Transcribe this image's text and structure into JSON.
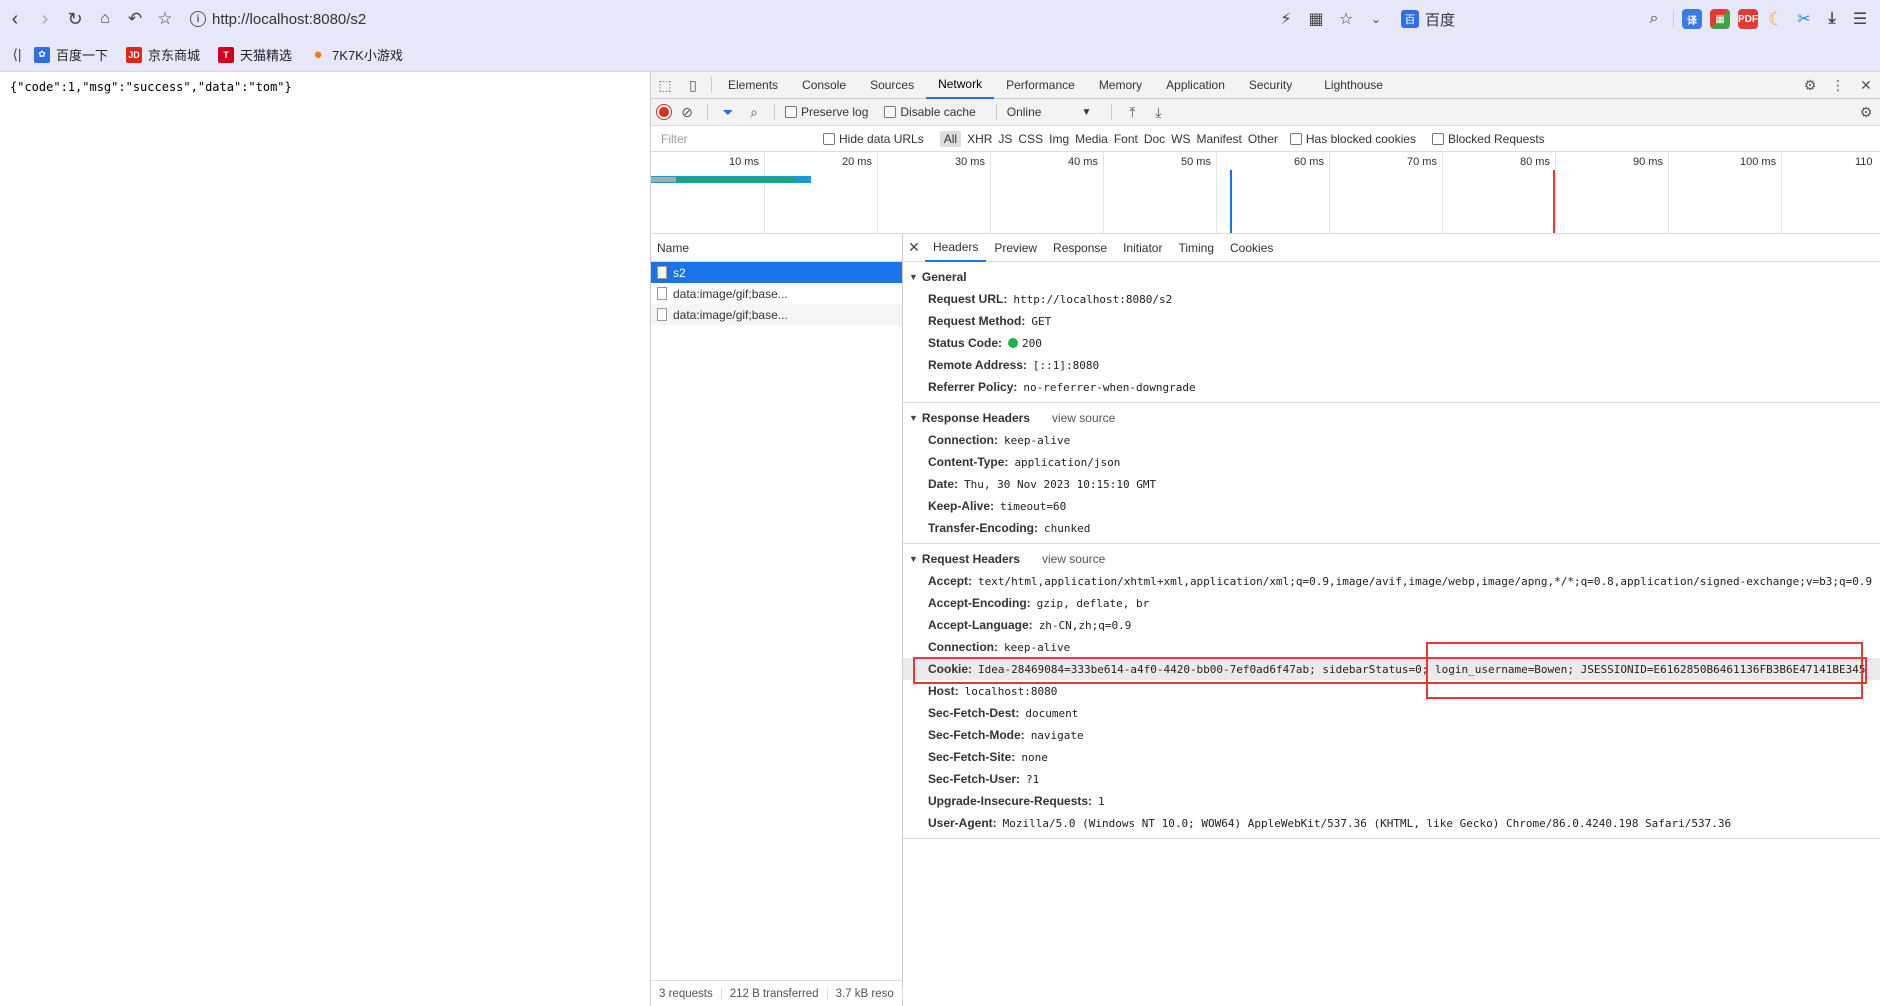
{
  "browser": {
    "url": "http://localhost:8080/s2",
    "search_engine": "百度",
    "bookmarks": [
      {
        "label": "百度一下",
        "icon": "baidu-paw-icon",
        "color": "#2f6fe6",
        "glyph": "🐾"
      },
      {
        "label": "京东商城",
        "icon": "jd-logo-icon",
        "color": "#e1251b",
        "glyph": "JD"
      },
      {
        "label": "天猫精选",
        "icon": "tmall-logo-icon",
        "color": "#d1001f",
        "glyph": "T"
      },
      {
        "label": "7K7K小游戏",
        "icon": "balloon-icon",
        "color": "#f57c00",
        "glyph": "●"
      }
    ]
  },
  "page": {
    "json_text": "{\"code\":1,\"msg\":\"success\",\"data\":\"tom\"}"
  },
  "devtools": {
    "tabs": [
      "Elements",
      "Console",
      "Sources",
      "Network",
      "Performance",
      "Memory",
      "Application",
      "Security",
      "Lighthouse"
    ],
    "active_tab": "Network",
    "toolbar": {
      "preserve_log": "Preserve log",
      "disable_cache": "Disable cache",
      "throttle": "Online"
    },
    "filter": {
      "placeholder": "Filter",
      "hide_data_urls": "Hide data URLs",
      "types": [
        "All",
        "XHR",
        "JS",
        "CSS",
        "Img",
        "Media",
        "Font",
        "Doc",
        "WS",
        "Manifest",
        "Other"
      ],
      "has_blocked_cookies": "Has blocked cookies",
      "blocked_requests": "Blocked Requests"
    },
    "timeline_ticks": [
      "10 ms",
      "20 ms",
      "30 ms",
      "40 ms",
      "50 ms",
      "60 ms",
      "70 ms",
      "80 ms",
      "90 ms",
      "100 ms",
      "110"
    ],
    "name_header": "Name",
    "requests": [
      "s2",
      "data:image/gif;base...",
      "data:image/gif;base..."
    ],
    "footer": {
      "requests": "3 requests",
      "transferred": "212 B transferred",
      "resources": "3.7 kB reso"
    },
    "detail_tabs": [
      "Headers",
      "Preview",
      "Response",
      "Initiator",
      "Timing",
      "Cookies"
    ],
    "general": {
      "title": "General",
      "rows": [
        {
          "key": "Request URL:",
          "value": "http://localhost:8080/s2"
        },
        {
          "key": "Request Method:",
          "value": "GET"
        },
        {
          "key": "Status Code:",
          "value": "200"
        },
        {
          "key": "Remote Address:",
          "value": "[::1]:8080"
        },
        {
          "key": "Referrer Policy:",
          "value": "no-referrer-when-downgrade"
        }
      ]
    },
    "response_headers": {
      "title": "Response Headers",
      "view_source": "view source",
      "rows": [
        {
          "key": "Connection:",
          "value": "keep-alive"
        },
        {
          "key": "Content-Type:",
          "value": "application/json"
        },
        {
          "key": "Date:",
          "value": "Thu, 30 Nov 2023 10:15:10 GMT"
        },
        {
          "key": "Keep-Alive:",
          "value": "timeout=60"
        },
        {
          "key": "Transfer-Encoding:",
          "value": "chunked"
        }
      ]
    },
    "request_headers": {
      "title": "Request Headers",
      "view_source": "view source",
      "rows": [
        {
          "key": "Accept:",
          "value": "text/html,application/xhtml+xml,application/xml;q=0.9,image/avif,image/webp,image/apng,*/*;q=0.8,application/signed-exchange;v=b3;q=0.9"
        },
        {
          "key": "Accept-Encoding:",
          "value": "gzip, deflate, br"
        },
        {
          "key": "Accept-Language:",
          "value": "zh-CN,zh;q=0.9"
        },
        {
          "key": "Connection:",
          "value": "keep-alive"
        },
        {
          "key": "Cookie:",
          "value": "Idea-28469084=333be614-a4f0-4420-bb00-7ef0ad6f47ab; sidebarStatus=0; login_username=Bowen; JSESSIONID=E6162850B6461136FB3B6E47141BE345"
        },
        {
          "key": "Host:",
          "value": "localhost:8080"
        },
        {
          "key": "Sec-Fetch-Dest:",
          "value": "document"
        },
        {
          "key": "Sec-Fetch-Mode:",
          "value": "navigate"
        },
        {
          "key": "Sec-Fetch-Site:",
          "value": "none"
        },
        {
          "key": "Sec-Fetch-User:",
          "value": "?1"
        },
        {
          "key": "Upgrade-Insecure-Requests:",
          "value": "1"
        },
        {
          "key": "User-Agent:",
          "value": "Mozilla/5.0 (Windows NT 10.0; WOW64) AppleWebKit/537.36 (KHTML, like Gecko) Chrome/86.0.4240.198 Safari/537.36"
        }
      ]
    }
  }
}
